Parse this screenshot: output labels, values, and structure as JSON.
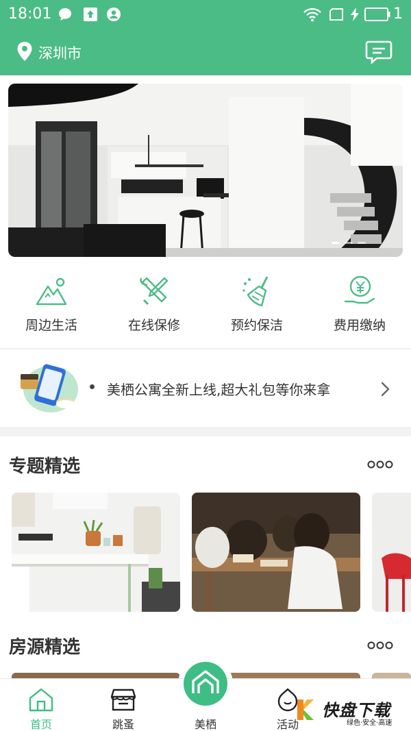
{
  "status_bar": {
    "time": "18:01",
    "battery_text": "1",
    "icons": [
      "chat-bubble-icon",
      "upload-icon",
      "account-icon",
      "wifi-icon",
      "sim-icon",
      "charging-icon",
      "battery-icon"
    ]
  },
  "header": {
    "location": "深圳市",
    "icons": [
      "location-pin-icon",
      "message-icon"
    ],
    "bg_color": "#4cbc86"
  },
  "banner": {
    "active_index": 0,
    "page_count": 3
  },
  "services": [
    {
      "label": "周边生活",
      "icon": "mountain-icon"
    },
    {
      "label": "在线保修",
      "icon": "wrench-screwdriver-icon"
    },
    {
      "label": "预约保洁",
      "icon": "broom-icon"
    },
    {
      "label": "费用缴纳",
      "icon": "yen-hand-icon"
    }
  ],
  "notice": {
    "text": "美栖公寓全新上线,超大礼包等你来拿",
    "icon": "chevron-right-icon"
  },
  "sections": {
    "topics": {
      "title": "专题精选",
      "more_icon": "more-icon"
    },
    "listings": {
      "title": "房源精选",
      "more_icon": "more-icon"
    }
  },
  "bottom_nav": [
    {
      "label": "首页",
      "icon": "home-icon",
      "active": true
    },
    {
      "label": "跳蚤",
      "icon": "market-icon",
      "active": false
    },
    {
      "label": "美栖",
      "icon": "brand-house-icon",
      "active": false
    },
    {
      "label": "活动",
      "icon": "activity-icon",
      "active": false
    }
  ],
  "watermark": {
    "title": "快盘下载",
    "sub": "绿色·安全·高速"
  },
  "colors": {
    "primary": "#4cbc86",
    "nav_active": "#3ebd85",
    "text": "#333333"
  }
}
